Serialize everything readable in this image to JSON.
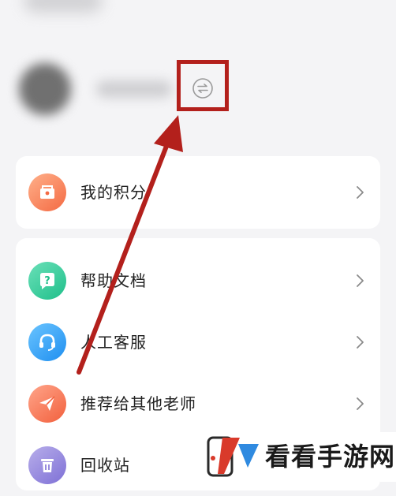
{
  "menu_group_1": {
    "items": [
      {
        "label": "我的积分",
        "icon": "points-icon"
      }
    ]
  },
  "menu_group_2": {
    "items": [
      {
        "label": "帮助文档",
        "icon": "help-question-icon"
      },
      {
        "label": "人工客服",
        "icon": "headset-icon"
      },
      {
        "label": "推荐给其他老师",
        "icon": "paper-plane-icon"
      },
      {
        "label": "回收站",
        "icon": "trash-icon"
      }
    ]
  },
  "profile": {
    "switch_icon": "switch-account-icon"
  },
  "annotation": {
    "highlight_color": "#b3201c",
    "arrow_color": "#b3201c"
  },
  "watermark": {
    "text": "看看手游网"
  }
}
